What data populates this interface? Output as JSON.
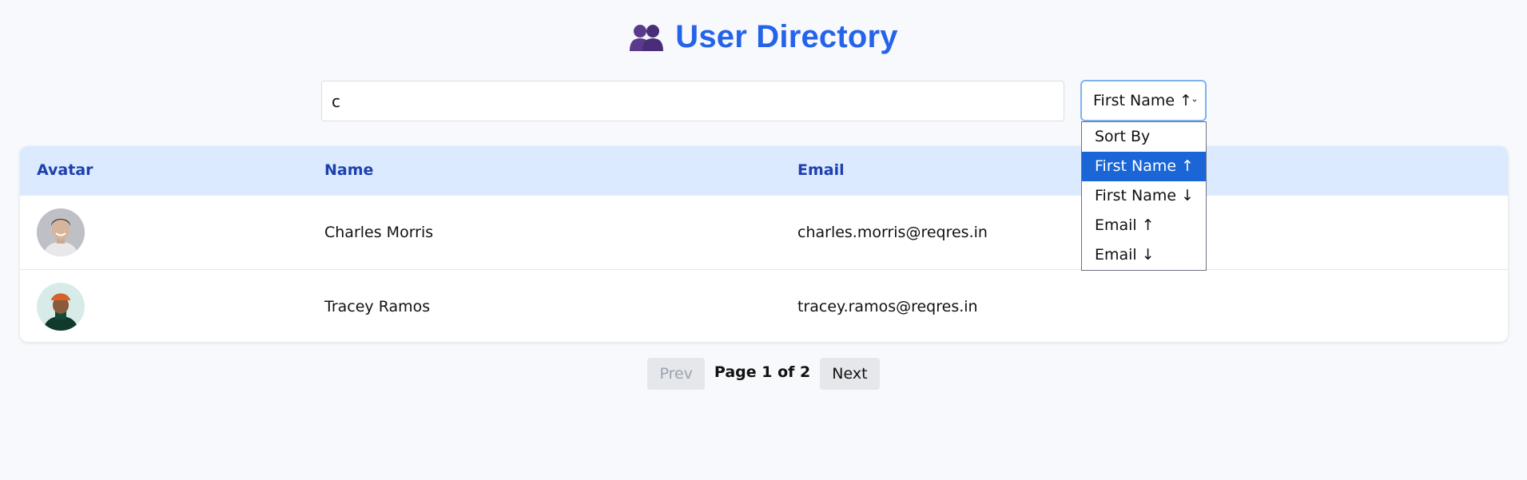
{
  "header": {
    "title": "User Directory",
    "icon": "users-icon"
  },
  "search": {
    "value": "c",
    "placeholder": ""
  },
  "sort": {
    "selected": "First Name ↑",
    "options": [
      "Sort By",
      "First Name ↑",
      "First Name ↓",
      "Email ↑",
      "Email ↓"
    ],
    "highlighted_index": 1
  },
  "table": {
    "columns": [
      "Avatar",
      "Name",
      "Email"
    ],
    "rows": [
      {
        "name": "Charles Morris",
        "email": "charles.morris@reqres.in"
      },
      {
        "name": "Tracey Ramos",
        "email": "tracey.ramos@reqres.in"
      }
    ]
  },
  "pagination": {
    "prev_label": "Prev",
    "page_info": "Page 1 of 2",
    "next_label": "Next"
  },
  "colors": {
    "title": "#2563eb",
    "header_bg": "#dbeafe",
    "header_text": "#1e40af",
    "selected_option": "#1a66d6"
  }
}
